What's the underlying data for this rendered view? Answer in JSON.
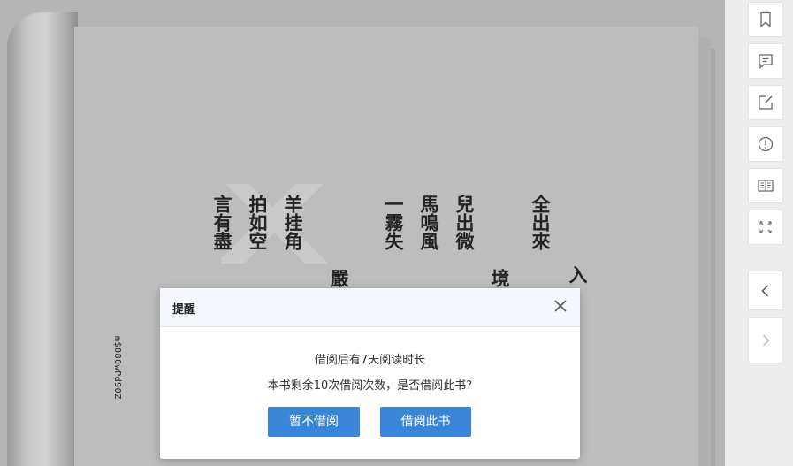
{
  "book": {
    "spine_code": "m$080wPd90Z",
    "text_columns": [
      "言有盡",
      "拍如空",
      "羊挂角",
      "嚴",
      "一霧失",
      "馬鳴風",
      "兒出微",
      "境",
      "全出來",
      "入"
    ]
  },
  "dialog": {
    "title": "提醒",
    "line1": "借阅后有7天阅读时长",
    "line2": "本书剩余10次借阅次数，是否借阅此书?",
    "cancel_label": "暂不借阅",
    "confirm_label": "借阅此书"
  },
  "toolbar": {
    "icons": [
      "bookmark-icon",
      "comment-icon",
      "edit-note-icon",
      "report-icon",
      "book-view-icon",
      "fullscreen-icon",
      "prev-page-icon",
      "next-page-icon"
    ]
  },
  "colors": {
    "primary_button": "#3a85d6",
    "overlay_page": "#bdbdbd"
  }
}
